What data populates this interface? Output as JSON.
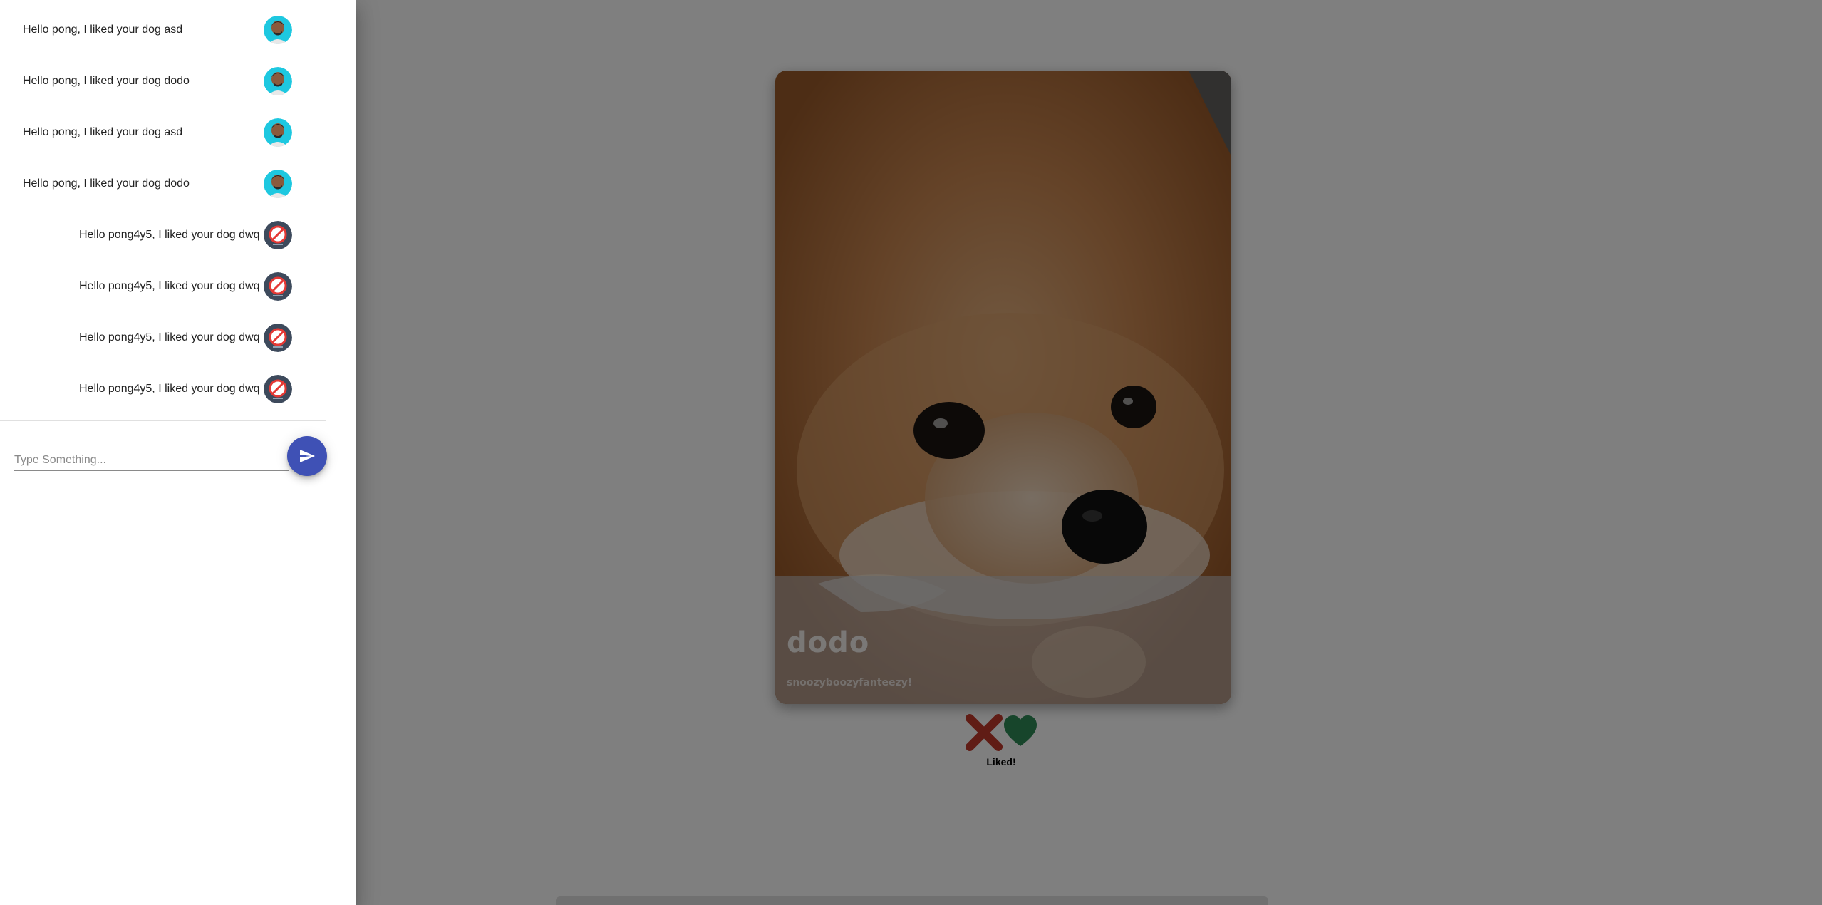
{
  "card": {
    "name": "dodo",
    "bio": "snoozyboozyfanteezy!"
  },
  "actions": {
    "dislike_icon": "close-x-icon",
    "like_icon": "heart-icon",
    "status": "Liked!"
  },
  "chat": {
    "messages": [
      {
        "text": "Hello pong, I liked your dog asd",
        "avatar": "person-avatar",
        "side": "left"
      },
      {
        "text": "Hello pong, I liked your dog dodo",
        "avatar": "person-avatar",
        "side": "left"
      },
      {
        "text": "Hello pong, I liked your dog asd",
        "avatar": "person-avatar",
        "side": "left"
      },
      {
        "text": "Hello pong, I liked your dog dodo",
        "avatar": "person-avatar",
        "side": "left"
      },
      {
        "text": "Hello pong4y5, I liked your dog dwq",
        "avatar": "no-image-avatar",
        "side": "right"
      },
      {
        "text": "Hello pong4y5, I liked your dog dwq",
        "avatar": "no-image-avatar",
        "side": "right"
      },
      {
        "text": "Hello pong4y5, I liked your dog dwq",
        "avatar": "no-image-avatar",
        "side": "right"
      },
      {
        "text": "Hello pong4y5, I liked your dog dwq",
        "avatar": "no-image-avatar",
        "side": "right"
      }
    ],
    "input_placeholder": "Type Something...",
    "input_value": "",
    "send_icon": "send-icon"
  },
  "colors": {
    "send_button": "#3f51b5",
    "avatar_bg": "#1ec8e0",
    "dislike": "#c0392b",
    "like": "#2e8b57"
  }
}
